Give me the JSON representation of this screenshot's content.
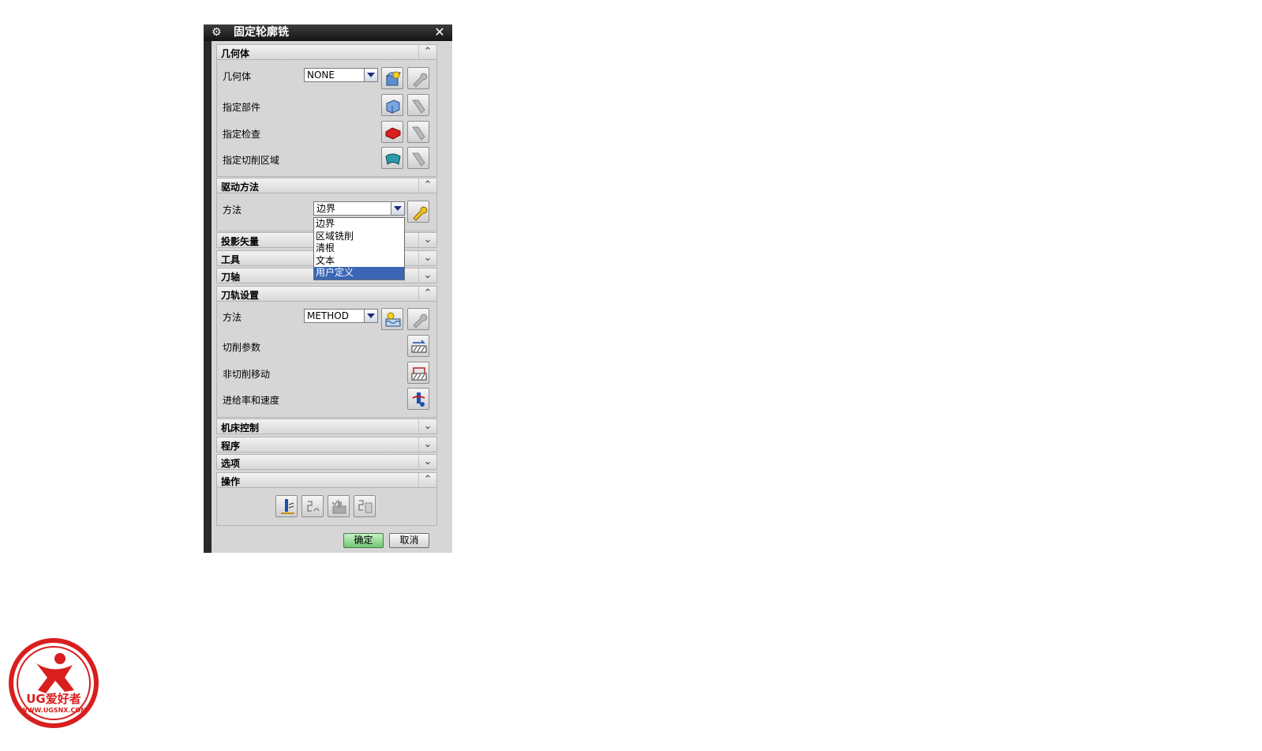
{
  "dialog": {
    "title": "固定轮廓铣",
    "close_glyph": "✕",
    "sections": {
      "geometry": {
        "header": "几何体",
        "geometry_label": "几何体",
        "geometry_value": "NONE",
        "part_label": "指定部件",
        "check_label": "指定检查",
        "cut_area_label": "指定切削区域"
      },
      "drive": {
        "header": "驱动方法",
        "method_label": "方法",
        "method_value": "边界",
        "options": [
          "边界",
          "区域铣削",
          "清根",
          "文本",
          "用户定义"
        ],
        "highlighted_option": "用户定义"
      },
      "projection_vector": {
        "header": "投影矢量"
      },
      "tool": {
        "header": "工具"
      },
      "tool_axis": {
        "header": "刀轴"
      },
      "path_settings": {
        "header": "刀轨设置",
        "method_label": "方法",
        "method_value": "METHOD",
        "cut_params_label": "切削参数",
        "non_cut_label": "非切削移动",
        "feeds_label": "进给率和速度"
      },
      "machine_control": {
        "header": "机床控制"
      },
      "program": {
        "header": "程序"
      },
      "options": {
        "header": "选项"
      },
      "actions": {
        "header": "操作"
      }
    },
    "ok_label": "确定",
    "cancel_label": "取消"
  },
  "watermark": {
    "brand": "UG爱好者",
    "url": "WWW.UGSNX.COM"
  }
}
